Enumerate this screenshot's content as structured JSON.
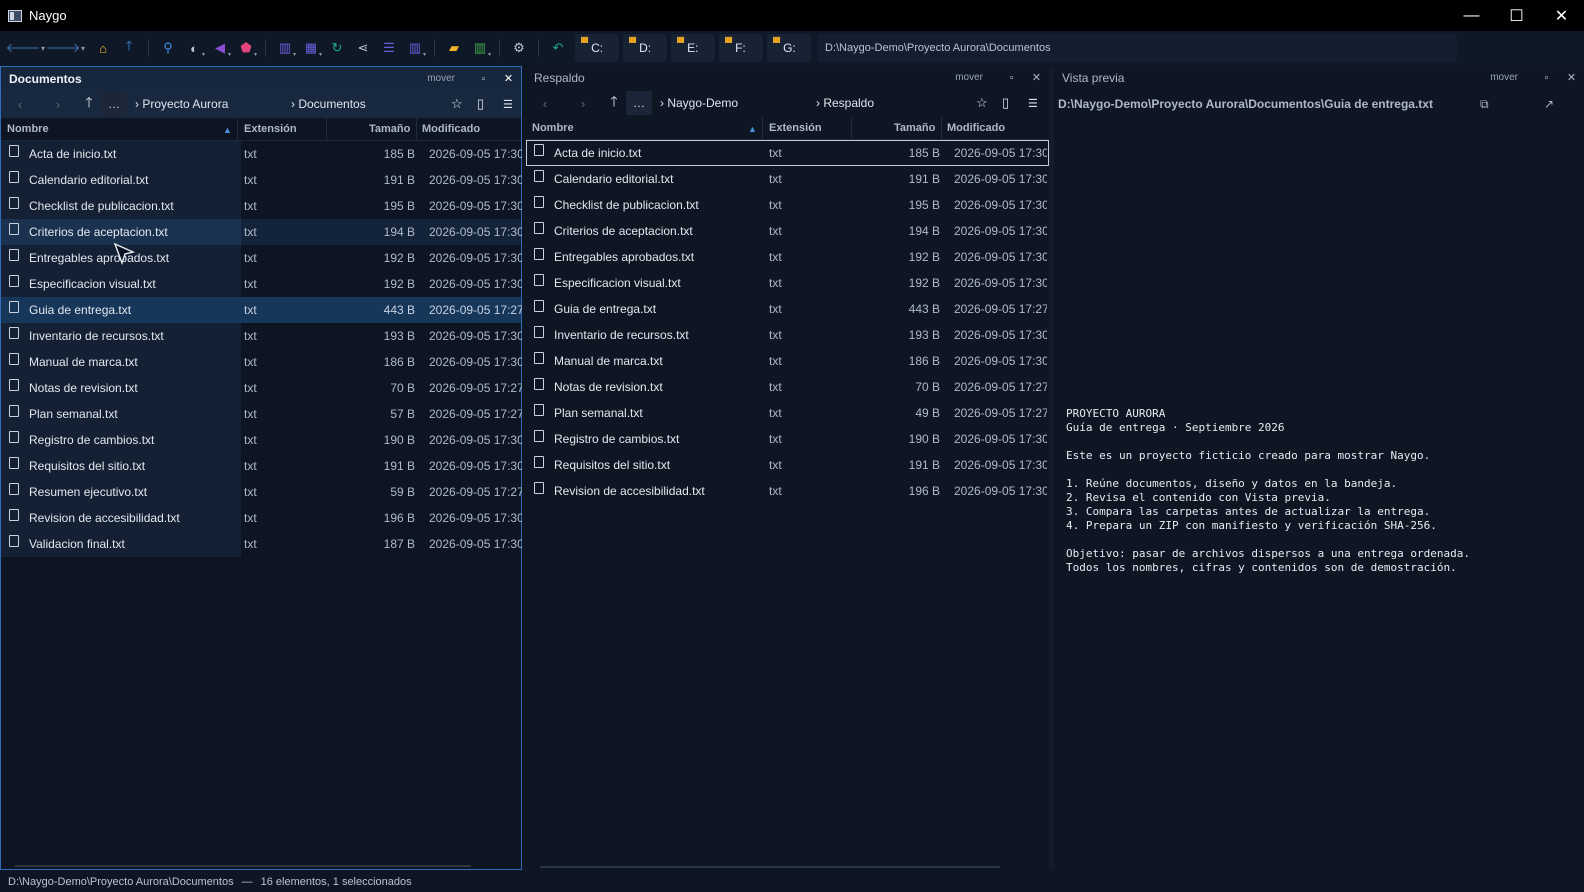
{
  "window": {
    "title": "Naygo",
    "minimize": "—",
    "maximize": "☐",
    "close": "✕"
  },
  "toolbar": {
    "drives": [
      "C:",
      "D:",
      "E:",
      "F:",
      "G:"
    ],
    "path": "D:\\Naygo-Demo\\Proyecto Aurora\\Documentos"
  },
  "left": {
    "title": "Documentos",
    "mover": "mover",
    "crumbs": [
      "› Proyecto Aurora",
      "› Documentos"
    ],
    "ellipsis": "…",
    "columns": {
      "name": "Nombre",
      "ext": "Extensión",
      "size": "Tamaño",
      "modified": "Modificado"
    },
    "rows": [
      {
        "name": "Acta de inicio.txt",
        "ext": "txt",
        "size": "185 B",
        "modified": "2026-09-05 17:30"
      },
      {
        "name": "Calendario editorial.txt",
        "ext": "txt",
        "size": "191 B",
        "modified": "2026-09-05 17:30"
      },
      {
        "name": "Checklist de publicacion.txt",
        "ext": "txt",
        "size": "195 B",
        "modified": "2026-09-05 17:30"
      },
      {
        "name": "Criterios de aceptacion.txt",
        "ext": "txt",
        "size": "194 B",
        "modified": "2026-09-05 17:30"
      },
      {
        "name": "Entregables aprobados.txt",
        "ext": "txt",
        "size": "192 B",
        "modified": "2026-09-05 17:30"
      },
      {
        "name": "Especificacion visual.txt",
        "ext": "txt",
        "size": "192 B",
        "modified": "2026-09-05 17:30"
      },
      {
        "name": "Guia de entrega.txt",
        "ext": "txt",
        "size": "443 B",
        "modified": "2026-09-05 17:27"
      },
      {
        "name": "Inventario de recursos.txt",
        "ext": "txt",
        "size": "193 B",
        "modified": "2026-09-05 17:30"
      },
      {
        "name": "Manual de marca.txt",
        "ext": "txt",
        "size": "186 B",
        "modified": "2026-09-05 17:30"
      },
      {
        "name": "Notas de revision.txt",
        "ext": "txt",
        "size": "70 B",
        "modified": "2026-09-05 17:27"
      },
      {
        "name": "Plan semanal.txt",
        "ext": "txt",
        "size": "57 B",
        "modified": "2026-09-05 17:27"
      },
      {
        "name": "Registro de cambios.txt",
        "ext": "txt",
        "size": "190 B",
        "modified": "2026-09-05 17:30"
      },
      {
        "name": "Requisitos del sitio.txt",
        "ext": "txt",
        "size": "191 B",
        "modified": "2026-09-05 17:30"
      },
      {
        "name": "Resumen ejecutivo.txt",
        "ext": "txt",
        "size": "59 B",
        "modified": "2026-09-05 17:27"
      },
      {
        "name": "Revision de accesibilidad.txt",
        "ext": "txt",
        "size": "196 B",
        "modified": "2026-09-05 17:30"
      },
      {
        "name": "Validacion final.txt",
        "ext": "txt",
        "size": "187 B",
        "modified": "2026-09-05 17:30"
      }
    ]
  },
  "middle": {
    "title": "Respaldo",
    "mover": "mover",
    "crumbs": [
      "› Naygo-Demo",
      "› Respaldo"
    ],
    "ellipsis": "…",
    "columns": {
      "name": "Nombre",
      "ext": "Extensión",
      "size": "Tamaño",
      "modified": "Modificado"
    },
    "rows": [
      {
        "name": "Acta de inicio.txt",
        "ext": "txt",
        "size": "185 B",
        "modified": "2026-09-05 17:30"
      },
      {
        "name": "Calendario editorial.txt",
        "ext": "txt",
        "size": "191 B",
        "modified": "2026-09-05 17:30"
      },
      {
        "name": "Checklist de publicacion.txt",
        "ext": "txt",
        "size": "195 B",
        "modified": "2026-09-05 17:30"
      },
      {
        "name": "Criterios de aceptacion.txt",
        "ext": "txt",
        "size": "194 B",
        "modified": "2026-09-05 17:30"
      },
      {
        "name": "Entregables aprobados.txt",
        "ext": "txt",
        "size": "192 B",
        "modified": "2026-09-05 17:30"
      },
      {
        "name": "Especificacion visual.txt",
        "ext": "txt",
        "size": "192 B",
        "modified": "2026-09-05 17:30"
      },
      {
        "name": "Guia de entrega.txt",
        "ext": "txt",
        "size": "443 B",
        "modified": "2026-09-05 17:27"
      },
      {
        "name": "Inventario de recursos.txt",
        "ext": "txt",
        "size": "193 B",
        "modified": "2026-09-05 17:30"
      },
      {
        "name": "Manual de marca.txt",
        "ext": "txt",
        "size": "186 B",
        "modified": "2026-09-05 17:30"
      },
      {
        "name": "Notas de revision.txt",
        "ext": "txt",
        "size": "70 B",
        "modified": "2026-09-05 17:27"
      },
      {
        "name": "Plan semanal.txt",
        "ext": "txt",
        "size": "49 B",
        "modified": "2026-09-05 17:27"
      },
      {
        "name": "Registro de cambios.txt",
        "ext": "txt",
        "size": "190 B",
        "modified": "2026-09-05 17:30"
      },
      {
        "name": "Requisitos del sitio.txt",
        "ext": "txt",
        "size": "191 B",
        "modified": "2026-09-05 17:30"
      },
      {
        "name": "Revision de accesibilidad.txt",
        "ext": "txt",
        "size": "196 B",
        "modified": "2026-09-05 17:30"
      }
    ]
  },
  "preview": {
    "title": "Vista previa",
    "mover": "mover",
    "path": "D:\\Naygo-Demo\\Proyecto Aurora\\Documentos\\Guia de entrega.txt",
    "content": "PROYECTO AURORA\nGuía de entrega · Septiembre 2026\n\nEste es un proyecto ficticio creado para mostrar Naygo.\n\n1. Reúne documentos, diseño y datos en la bandeja.\n2. Revisa el contenido con Vista previa.\n3. Compara las carpetas antes de actualizar la entrega.\n4. Prepara un ZIP con manifiesto y verificación SHA-256.\n\nObjetivo: pasar de archivos dispersos a una entrega ordenada.\nTodos los nombres, cifras y contenidos son de demostración."
  },
  "status": {
    "path": "D:\\Naygo-Demo\\Proyecto Aurora\\Documentos",
    "sep": "—",
    "summary": "16 elementos, 1 seleccionados"
  }
}
